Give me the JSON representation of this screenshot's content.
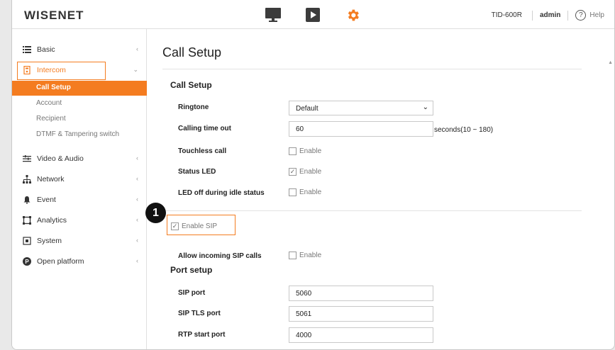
{
  "header": {
    "logo": "WISENET",
    "model": "TID-600R",
    "user": "admin",
    "help": "Help"
  },
  "sidebar": {
    "items": [
      {
        "label": "Basic",
        "icon": "list-icon"
      },
      {
        "label": "Intercom",
        "icon": "intercom-icon"
      },
      {
        "label": "Video & Audio",
        "icon": "video-audio-icon"
      },
      {
        "label": "Network",
        "icon": "network-icon"
      },
      {
        "label": "Event",
        "icon": "bell-icon"
      },
      {
        "label": "Analytics",
        "icon": "analytics-icon"
      },
      {
        "label": "System",
        "icon": "system-icon"
      },
      {
        "label": "Open platform",
        "icon": "open-platform-icon"
      }
    ],
    "intercom_sub": [
      {
        "label": "Call Setup"
      },
      {
        "label": "Account"
      },
      {
        "label": "Recipient"
      },
      {
        "label": "DTMF & Tampering switch"
      }
    ]
  },
  "main": {
    "title": "Call Setup",
    "section1": "Call Setup",
    "ringtone_label": "Ringtone",
    "ringtone_value": "Default",
    "calling_timeout_label": "Calling time out",
    "calling_timeout_value": "60",
    "calling_timeout_suffix": "seconds(10 ~ 180)",
    "touchless_label": "Touchless call",
    "status_led_label": "Status LED",
    "led_off_label": "LED off during idle status",
    "enable": "Enable",
    "enable_sip": "Enable SIP",
    "allow_incoming_label": "Allow incoming SIP calls",
    "section2": "Port setup",
    "sip_port_label": "SIP port",
    "sip_port_value": "5060",
    "sip_tls_label": "SIP TLS port",
    "sip_tls_value": "5061",
    "rtp_label": "RTP start port",
    "rtp_value": "4000",
    "badge": "1"
  },
  "colors": {
    "accent": "#f47c20"
  }
}
